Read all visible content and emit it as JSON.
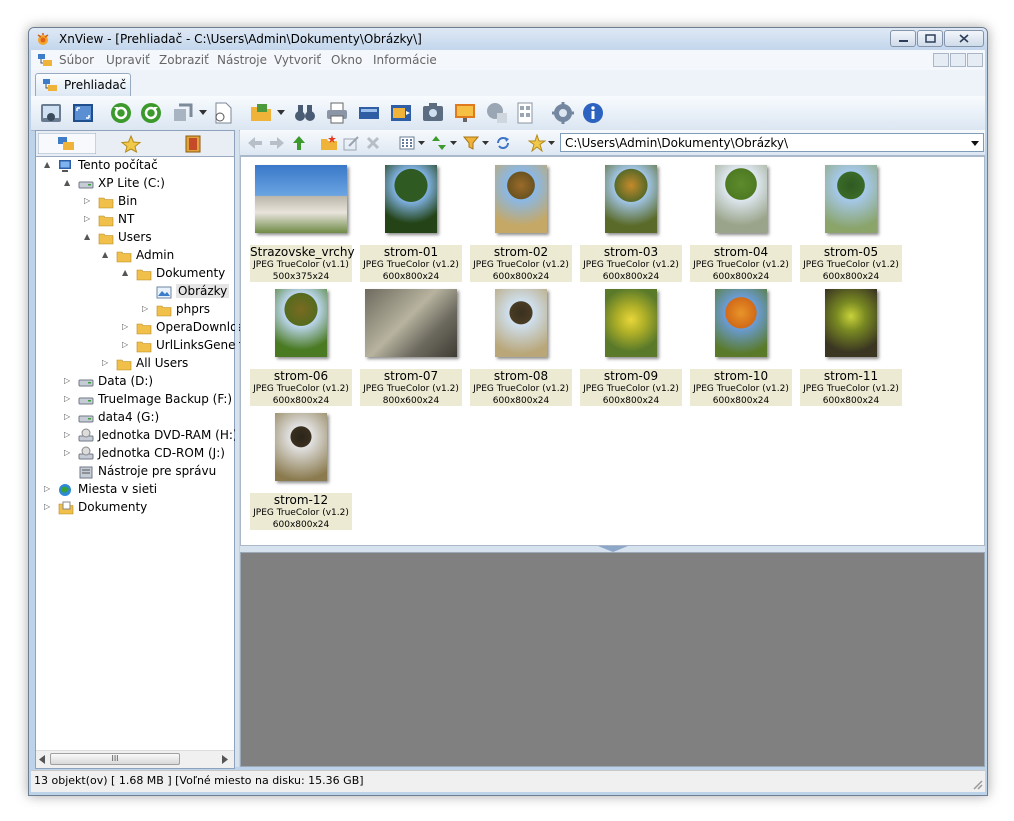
{
  "window": {
    "title": "XnView - [Prehliadač - C:\\Users\\Admin\\Dokumenty\\Obrázky\\]"
  },
  "menu": [
    "Súbor",
    "Upraviť",
    "Zobraziť",
    "Nástroje",
    "Vytvoriť",
    "Okno",
    "Informácie"
  ],
  "tab": {
    "label": "Prehliadač"
  },
  "address": {
    "path": "C:\\Users\\Admin\\Dokumenty\\Obrázky\\"
  },
  "tree": [
    {
      "label": "Tento počítač",
      "icon": "computer-icon"
    },
    {
      "label": "XP Lite (C:)",
      "icon": "drive-icon"
    },
    {
      "label": "Bin",
      "icon": "folder-icon"
    },
    {
      "label": "NT",
      "icon": "folder-icon"
    },
    {
      "label": "Users",
      "icon": "folder-icon"
    },
    {
      "label": "Admin",
      "icon": "folder-icon"
    },
    {
      "label": "Dokumenty",
      "icon": "folder-icon"
    },
    {
      "label": "Obrázky",
      "icon": "picture-folder-icon"
    },
    {
      "label": "phprs",
      "icon": "folder-icon"
    },
    {
      "label": "OperaDownloa",
      "icon": "folder-icon"
    },
    {
      "label": "UrlLinksGenera",
      "icon": "folder-icon"
    },
    {
      "label": "All Users",
      "icon": "folder-icon"
    },
    {
      "label": "Data (D:)",
      "icon": "drive-icon"
    },
    {
      "label": "TrueImage Backup (F:)",
      "icon": "drive-icon"
    },
    {
      "label": "data4 (G:)",
      "icon": "drive-icon"
    },
    {
      "label": "Jednotka DVD-RAM (H:)",
      "icon": "optical-drive-icon"
    },
    {
      "label": "Jednotka CD-ROM (J:)",
      "icon": "optical-drive-icon"
    },
    {
      "label": "Nástroje pre správu",
      "icon": "tools-icon"
    },
    {
      "label": "Miesta v sieti",
      "icon": "network-icon"
    },
    {
      "label": "Dokumenty",
      "icon": "documents-icon"
    }
  ],
  "thumbnails": [
    {
      "name": "Strazovske_vrchy",
      "format": "JPEG TrueColor (v1.1)",
      "dims": "500x375x24"
    },
    {
      "name": "strom-01",
      "format": "JPEG TrueColor (v1.2)",
      "dims": "600x800x24"
    },
    {
      "name": "strom-02",
      "format": "JPEG TrueColor (v1.2)",
      "dims": "600x800x24"
    },
    {
      "name": "strom-03",
      "format": "JPEG TrueColor (v1.2)",
      "dims": "600x800x24"
    },
    {
      "name": "strom-04",
      "format": "JPEG TrueColor (v1.2)",
      "dims": "600x800x24"
    },
    {
      "name": "strom-05",
      "format": "JPEG TrueColor (v1.2)",
      "dims": "600x800x24"
    },
    {
      "name": "strom-06",
      "format": "JPEG TrueColor (v1.2)",
      "dims": "600x800x24"
    },
    {
      "name": "strom-07",
      "format": "JPEG TrueColor (v1.2)",
      "dims": "800x600x24"
    },
    {
      "name": "strom-08",
      "format": "JPEG TrueColor (v1.2)",
      "dims": "600x800x24"
    },
    {
      "name": "strom-09",
      "format": "JPEG TrueColor (v1.2)",
      "dims": "600x800x24"
    },
    {
      "name": "strom-10",
      "format": "JPEG TrueColor (v1.2)",
      "dims": "600x800x24"
    },
    {
      "name": "strom-11",
      "format": "JPEG TrueColor (v1.2)",
      "dims": "600x800x24"
    },
    {
      "name": "strom-12",
      "format": "JPEG TrueColor (v1.2)",
      "dims": "600x800x24"
    }
  ],
  "status": {
    "text": "13 objekt(ov) [ 1.68 MB ] [Voľné miesto na disku: 15.36 GB]"
  },
  "scrollbar": {
    "grip": "III"
  }
}
